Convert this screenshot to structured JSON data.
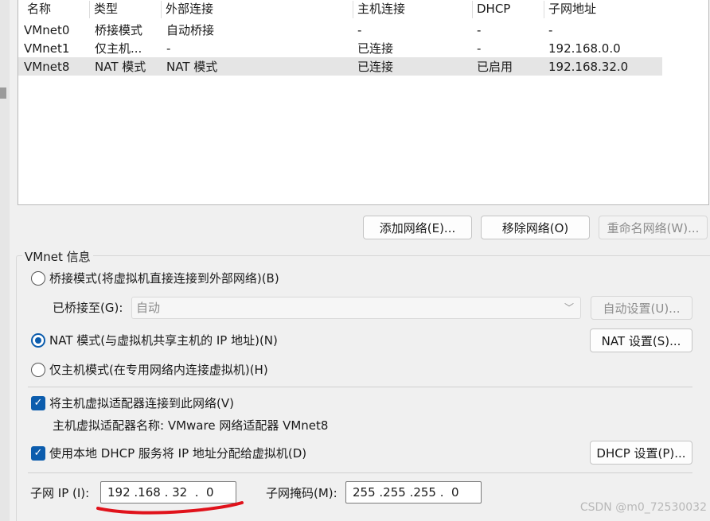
{
  "table": {
    "headers": [
      "名称",
      "类型",
      "外部连接",
      "主机连接",
      "DHCP",
      "子网地址"
    ],
    "rows": [
      {
        "name": "VMnet0",
        "type": "桥接模式",
        "external": "自动桥接",
        "host": "-",
        "dhcp": "-",
        "subnet": "-"
      },
      {
        "name": "VMnet1",
        "type": "仅主机...",
        "external": "-",
        "host": "已连接",
        "dhcp": "-",
        "subnet": "192.168.0.0"
      },
      {
        "name": "VMnet8",
        "type": "NAT 模式",
        "external": "NAT 模式",
        "host": "已连接",
        "dhcp": "已启用",
        "subnet": "192.168.32.0"
      }
    ],
    "selected_row": "VMnet8"
  },
  "buttons": {
    "add": "添加网络(E)...",
    "remove": "移除网络(O)",
    "rename": "重命名网络(W)..."
  },
  "vmnet_info": {
    "title": "VMnet 信息",
    "bridge_label": "桥接模式(将虚拟机直接连接到外部网络)(B)",
    "bridged_to_label": "已桥接至(G):",
    "bridged_to_value": "自动",
    "auto_settings": "自动设置(U)...",
    "nat_label": "NAT 模式(与虚拟机共享主机的 IP 地址)(N)",
    "nat_settings": "NAT 设置(S)...",
    "hostonly_label": "仅主机模式(在专用网络内连接虚拟机)(H)",
    "selected_mode": "nat",
    "connect_adapter_label": "将主机虚拟适配器连接到此网络(V)",
    "connect_adapter_checked": true,
    "adapter_name_label": "主机虚拟适配器名称: VMware 网络适配器 VMnet8",
    "dhcp_label": "使用本地 DHCP 服务将 IP 地址分配给虚拟机(D)",
    "dhcp_checked": true,
    "dhcp_settings": "DHCP 设置(P)...",
    "subnet_ip_label": "子网 IP (I):",
    "subnet_ip": "192 .168 . 32  .  0",
    "subnet_mask_label": "子网掩码(M):",
    "subnet_mask": "255 .255 .255 .  0"
  },
  "icons": {
    "check": "✓",
    "chevron": "﹀"
  },
  "colors": {
    "accent": "#0b5cad",
    "annotation": "#e0121b",
    "selection": "#e5e5e5"
  },
  "watermark": "CSDN @m0_72530032"
}
